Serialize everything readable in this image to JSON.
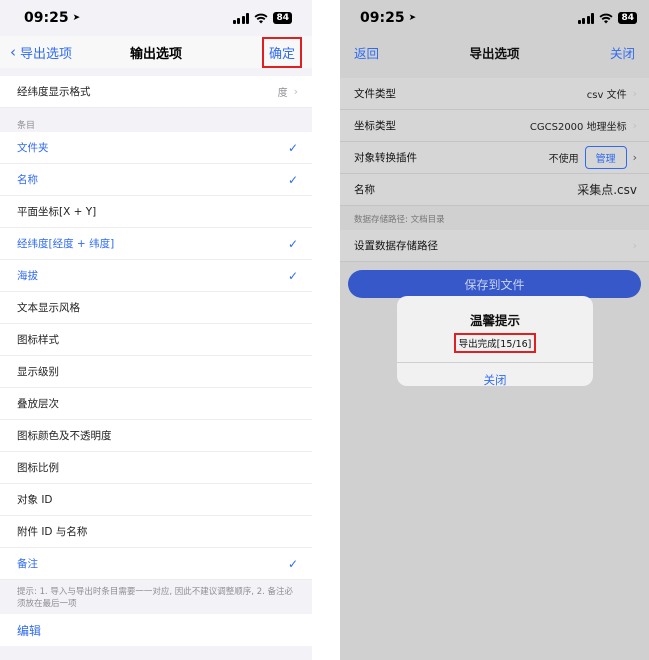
{
  "left": {
    "status": {
      "time": "09:25",
      "battery": "84"
    },
    "nav": {
      "back_label": "导出选项",
      "title": "输出选项",
      "confirm_label": "确定"
    },
    "format_row": {
      "label": "经纬度显示格式",
      "value": "度"
    },
    "section_title": "条目",
    "items": [
      {
        "label": "文件夹",
        "checked": true
      },
      {
        "label": "名称",
        "checked": true
      },
      {
        "label": "平面坐标[X + Y]",
        "checked": false
      },
      {
        "label": "经纬度[经度 + 纬度]",
        "checked": true
      },
      {
        "label": "海拔",
        "checked": true
      },
      {
        "label": "文本显示风格",
        "checked": false
      },
      {
        "label": "图标样式",
        "checked": false
      },
      {
        "label": "显示级别",
        "checked": false
      },
      {
        "label": "叠放层次",
        "checked": false
      },
      {
        "label": "图标颜色及不透明度",
        "checked": false
      },
      {
        "label": "图标比例",
        "checked": false
      },
      {
        "label": "对象 ID",
        "checked": false
      },
      {
        "label": "附件 ID 与名称",
        "checked": false
      },
      {
        "label": "备注",
        "checked": true
      }
    ],
    "hint": "提示: 1. 导入与导出时条目需要一一对应, 因此不建议调整顺序, 2. 备注必须放在最后一项",
    "edit_label": "编辑"
  },
  "right": {
    "status": {
      "time": "09:25",
      "battery": "84"
    },
    "nav": {
      "back_label": "返回",
      "title": "导出选项",
      "close_label": "关闭"
    },
    "rows": {
      "file_type": {
        "label": "文件类型",
        "value": "csv 文件"
      },
      "coord_type": {
        "label": "坐标类型",
        "value": "CGCS2000 地理坐标"
      },
      "plugin": {
        "label": "对象转换插件",
        "value": "不使用",
        "manage_label": "管理"
      },
      "name": {
        "label": "名称",
        "value": "采集点.csv"
      }
    },
    "storage_section": "数据存储路径: 文档目录",
    "storage_row": {
      "label": "设置数据存储路径"
    },
    "save_button": "保存到文件",
    "dialog": {
      "title": "温馨提示",
      "message": "导出完成[15/16]",
      "close_label": "关闭"
    }
  },
  "colors": {
    "accent": "#2f6bf1",
    "highlight_box": "#e02020",
    "save_button": "#3658c8"
  }
}
